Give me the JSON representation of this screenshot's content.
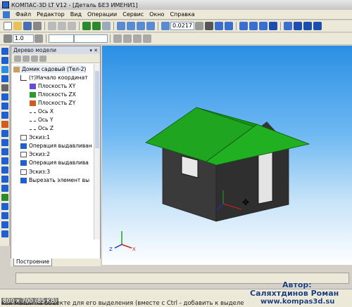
{
  "window": {
    "title": "КОМПАС-3D LT V12 - [Деталь БЕЗ ИМЕНИ1]"
  },
  "menu": [
    "Файл",
    "Редактор",
    "Вид",
    "Операции",
    "Сервис",
    "Окно",
    "Справка"
  ],
  "toolbar": {
    "zoom_value": "0.0217",
    "step_value": "1.0"
  },
  "tree": {
    "title": "Дерево модели",
    "items": [
      {
        "label": "Домик садовый (Тел-2)",
        "icon": "part-icon",
        "color": "#c8a060"
      },
      {
        "label": "(т)Начало координат",
        "icon": "origin-icon",
        "color": "#333333"
      },
      {
        "label": "Плоскость XY",
        "icon": "plane-xy-icon",
        "color": "#6a4cd0"
      },
      {
        "label": "Плоскость ZX",
        "icon": "plane-zx-icon",
        "color": "#2e9b2e"
      },
      {
        "label": "Плоскость ZY",
        "icon": "plane-zy-icon",
        "color": "#d05a20"
      },
      {
        "label": "Ось X",
        "icon": "axis-x-icon",
        "color": "#3a3a3a"
      },
      {
        "label": "Ось Y",
        "icon": "axis-y-icon",
        "color": "#3a3a3a"
      },
      {
        "label": "Ось Z",
        "icon": "axis-z-icon",
        "color": "#3a3a3a"
      },
      {
        "label": "Эскиз:1",
        "icon": "sketch-icon",
        "color": "#555555"
      },
      {
        "label": "Операция выдавливан",
        "icon": "extrude-icon",
        "color": "#1f5fd0"
      },
      {
        "label": "Эскиз:2",
        "icon": "sketch-icon",
        "color": "#555555"
      },
      {
        "label": "Операция выдавлива",
        "icon": "extrude-icon",
        "color": "#1f5fd0"
      },
      {
        "label": "Эскиз:3",
        "icon": "sketch-icon",
        "color": "#555555"
      },
      {
        "label": "Вырезать элемент вы",
        "icon": "cut-icon",
        "color": "#1f5fd0"
      }
    ]
  },
  "tabs": {
    "build": "Построение"
  },
  "status": {
    "hint": "кой мыши на объекте для его выделения (вместе с Ctrl - добавить к выделе"
  },
  "overlay": {
    "size_label": "800 x 700 (85 KB)",
    "author_label": "Автор:",
    "author_name": "Саляхтдинов  Роман",
    "site": "www.kompas3d.su"
  },
  "axes": {
    "z": "Z",
    "x": "X"
  },
  "colors": {
    "roof": "#1fa51f",
    "walls": "#3a3a3a",
    "accent": "#2a8fe4"
  }
}
